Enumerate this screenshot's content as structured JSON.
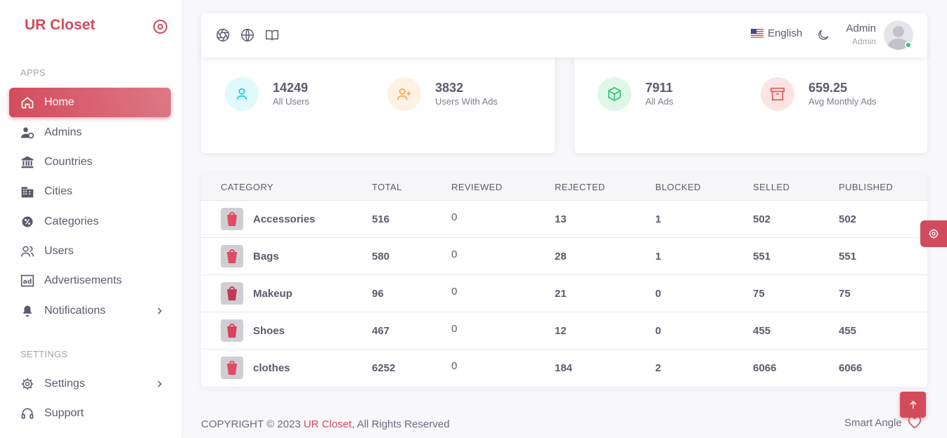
{
  "brand": {
    "name": "UR Closet",
    "accent": "#d24b5c"
  },
  "sidebar": {
    "sections": [
      {
        "label": "APPS"
      },
      {
        "label": "SETTINGS"
      }
    ],
    "items": [
      {
        "label": "Home",
        "icon": "home-icon",
        "active": true
      },
      {
        "label": "Admins",
        "icon": "admin-user-icon"
      },
      {
        "label": "Countries",
        "icon": "bank-icon"
      },
      {
        "label": "Cities",
        "icon": "buildings-icon"
      },
      {
        "label": "Categories",
        "icon": "category-icon"
      },
      {
        "label": "Users",
        "icon": "users-icon"
      },
      {
        "label": "Advertisements",
        "icon": "ad-icon"
      },
      {
        "label": "Notifications",
        "icon": "bell-icon"
      },
      {
        "label": "Settings",
        "icon": "gear-icon"
      },
      {
        "label": "Support",
        "icon": "headset-icon"
      }
    ]
  },
  "navbar": {
    "language": "English",
    "user": {
      "name": "Admin",
      "role": "Admin"
    }
  },
  "stats": [
    {
      "value": "14249",
      "label": "All Users",
      "icon": "user-icon",
      "color": "#00cfe8"
    },
    {
      "value": "3832",
      "label": "Users With Ads",
      "icon": "user-plus-icon",
      "color": "#ff9f43"
    },
    {
      "value": "7911",
      "label": "All Ads",
      "icon": "box-icon",
      "color": "#28c76f"
    },
    {
      "value": "659.25",
      "label": "Avg Monthly Ads",
      "icon": "archive-icon",
      "color": "#ea5455"
    }
  ],
  "table": {
    "columns": [
      "CATEGORY",
      "TOTAL",
      "REVIEWED",
      "REJECTED",
      "BLOCKED",
      "SELLED",
      "PUBLISHED"
    ],
    "rows": [
      {
        "category": "Accessories",
        "total": "516",
        "reviewed": "0",
        "rejected": "13",
        "blocked": "1",
        "selled": "502",
        "published": "502"
      },
      {
        "category": "Bags",
        "total": "580",
        "reviewed": "0",
        "rejected": "28",
        "blocked": "1",
        "selled": "551",
        "published": "551"
      },
      {
        "category": "Makeup",
        "total": "96",
        "reviewed": "0",
        "rejected": "21",
        "blocked": "0",
        "selled": "75",
        "published": "75"
      },
      {
        "category": "Shoes",
        "total": "467",
        "reviewed": "0",
        "rejected": "12",
        "blocked": "0",
        "selled": "455",
        "published": "455"
      },
      {
        "category": "clothes",
        "total": "6252",
        "reviewed": "0",
        "rejected": "184",
        "blocked": "2",
        "selled": "6066",
        "published": "6066"
      }
    ]
  },
  "footer": {
    "prefix": "COPYRIGHT © 2023 ",
    "brand_link": "UR Closet",
    "suffix": ", All Rights Reserved",
    "right": "Smart Angle"
  }
}
